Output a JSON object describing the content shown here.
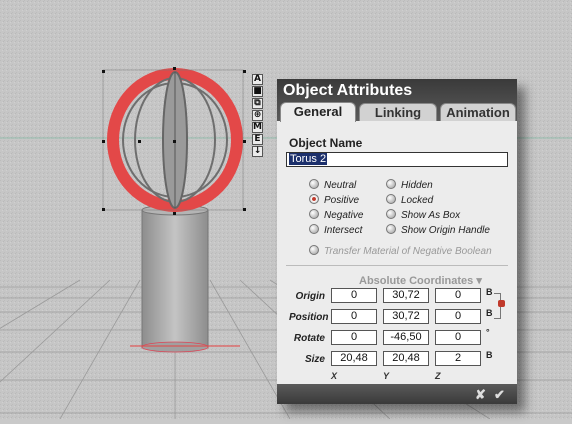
{
  "tool_palette": [
    {
      "icon": "anchor-a-icon",
      "glyph": "A"
    },
    {
      "icon": "square-icon",
      "glyph": "■"
    },
    {
      "icon": "scale-icon",
      "glyph": "⧉"
    },
    {
      "icon": "target-icon",
      "glyph": "⊕"
    },
    {
      "icon": "move-icon",
      "glyph": "M"
    },
    {
      "icon": "edit-icon",
      "glyph": "E"
    },
    {
      "icon": "drop-icon",
      "glyph": "↓"
    }
  ],
  "panel": {
    "title": "Object Attributes",
    "tabs": [
      "General",
      "Linking",
      "Animation"
    ],
    "active_tab": "General",
    "object_name_label": "Object Name",
    "object_name_value": "Torus 2",
    "boolean_options": [
      {
        "label": "Neutral",
        "selected": false
      },
      {
        "label": "Positive",
        "selected": true
      },
      {
        "label": "Negative",
        "selected": false
      },
      {
        "label": "Intersect",
        "selected": false
      }
    ],
    "visibility_options": [
      {
        "label": "Hidden"
      },
      {
        "label": "Locked"
      },
      {
        "label": "Show As Box"
      },
      {
        "label": "Show Origin Handle"
      }
    ],
    "transfer_option": "Transfer Material of Negative Boolean",
    "coords_title": "Absolute Coordinates",
    "rows": [
      {
        "label": "Origin",
        "x": "0",
        "y": "30,72",
        "z": "0",
        "unit": "B"
      },
      {
        "label": "Position",
        "x": "0",
        "y": "30,72",
        "z": "0",
        "unit": "B"
      },
      {
        "label": "Rotate",
        "x": "0",
        "y": "-46,50",
        "z": "0",
        "unit": "°"
      },
      {
        "label": "Size",
        "x": "20,48",
        "y": "20,48",
        "z": "2",
        "unit": "B"
      }
    ],
    "axes": [
      "X",
      "Y",
      "Z"
    ],
    "footer": {
      "cancel": "✘",
      "ok": "✔"
    }
  },
  "colors": {
    "torus": "#e34848",
    "panel_header": "#4a4a4a",
    "selected_radio": "#c0392b"
  }
}
